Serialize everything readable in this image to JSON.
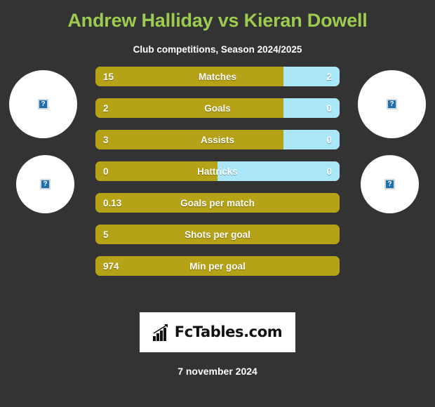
{
  "header": {
    "title": "Andrew Halliday vs Kieran Dowell",
    "subtitle": "Club competitions, Season 2024/2025",
    "title_color": "#9dcb4f"
  },
  "colors": {
    "background": "#333333",
    "left_player_bar": "#b5a216",
    "right_player_bar": "#a9e7f9",
    "bar_border": "#c6b83f",
    "text": "#ffffff"
  },
  "avatars": [
    {
      "position": "left-top",
      "icon": "broken-image-icon",
      "glyph": "?"
    },
    {
      "position": "left-bottom",
      "icon": "broken-image-icon",
      "glyph": "?"
    },
    {
      "position": "right-top",
      "icon": "broken-image-icon",
      "glyph": "?"
    },
    {
      "position": "right-bottom",
      "icon": "broken-image-icon",
      "glyph": "?"
    }
  ],
  "chart_data": {
    "type": "bar",
    "title": "Andrew Halliday vs Kieran Dowell",
    "subtitle": "Club competitions, Season 2024/2025",
    "xlabel": "",
    "ylabel": "",
    "legend": [
      "Andrew Halliday",
      "Kieran Dowell"
    ],
    "categories": [
      "Matches",
      "Goals",
      "Assists",
      "Hattricks",
      "Goals per match",
      "Shots per goal",
      "Min per goal"
    ],
    "series": [
      {
        "name": "Andrew Halliday",
        "values": [
          15,
          2,
          3,
          0,
          0.13,
          5,
          974
        ]
      },
      {
        "name": "Kieran Dowell",
        "values": [
          2,
          0,
          0,
          0,
          null,
          null,
          null
        ]
      }
    ],
    "rows": [
      {
        "label": "Matches",
        "left_value": "15",
        "right_value": "2",
        "left_pct": 77,
        "right_pct": 23,
        "split": true
      },
      {
        "label": "Goals",
        "left_value": "2",
        "right_value": "0",
        "left_pct": 77,
        "right_pct": 23,
        "split": true
      },
      {
        "label": "Assists",
        "left_value": "3",
        "right_value": "0",
        "left_pct": 77,
        "right_pct": 23,
        "split": true
      },
      {
        "label": "Hattricks",
        "left_value": "0",
        "right_value": "0",
        "left_pct": 50,
        "right_pct": 50,
        "split": true
      },
      {
        "label": "Goals per match",
        "left_value": "0.13",
        "right_value": "",
        "left_pct": 100,
        "right_pct": 0,
        "split": false
      },
      {
        "label": "Shots per goal",
        "left_value": "5",
        "right_value": "",
        "left_pct": 100,
        "right_pct": 0,
        "split": false
      },
      {
        "label": "Min per goal",
        "left_value": "974",
        "right_value": "",
        "left_pct": 100,
        "right_pct": 0,
        "split": false
      }
    ]
  },
  "footer": {
    "logo_text": "FcTables.com",
    "logo_icon": "bar-chart-icon",
    "date": "7 november 2024"
  }
}
